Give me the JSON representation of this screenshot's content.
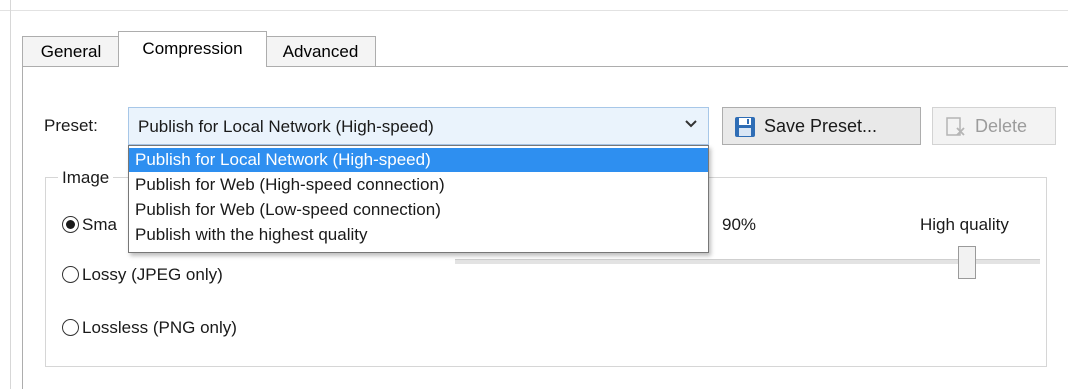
{
  "tabs": [
    {
      "label": "General"
    },
    {
      "label": "Compression"
    },
    {
      "label": "Advanced"
    }
  ],
  "preset": {
    "label": "Preset:",
    "selected": "Publish for Local Network (High-speed)",
    "options": [
      "Publish for Local Network (High-speed)",
      "Publish for Web (High-speed connection)",
      "Publish for Web (Low-speed connection)",
      "Publish with the highest quality"
    ]
  },
  "buttons": {
    "save_preset": "Save Preset...",
    "delete": "Delete"
  },
  "image_group": {
    "title": "Image",
    "radios": [
      {
        "label": "Sma",
        "checked": true
      },
      {
        "label": "Lossy (JPEG only)",
        "checked": false
      },
      {
        "label": "Lossless (PNG only)",
        "checked": false
      }
    ],
    "quality_percent": "90%",
    "quality_label": "High quality",
    "quality_value": 0.9
  },
  "colors": {
    "selection": "#2e8ff0",
    "combo_bg": "#eaf3fc",
    "save_icon": "#2f6db5"
  },
  "icons": {
    "save": "floppy-disk-icon",
    "delete": "delete-document-icon",
    "chevron": "chevron-down-icon"
  }
}
